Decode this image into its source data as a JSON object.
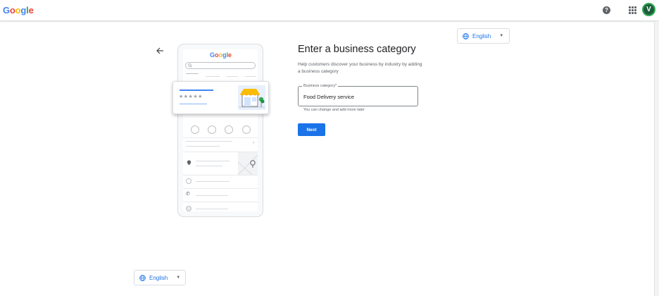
{
  "header": {
    "logo_letters": [
      "G",
      "o",
      "o",
      "g",
      "l",
      "e"
    ],
    "help_icon": "help-icon",
    "apps_icon": "apps-grid-icon",
    "avatar_letter": "V",
    "avatar_color": "#1b5e3b"
  },
  "language_top": {
    "label": "English",
    "icon": "globe-icon"
  },
  "language_bottom": {
    "label": "English",
    "icon": "globe-icon"
  },
  "back_icon": "arrow-back-icon",
  "illustration": {
    "logo_letters": [
      "G",
      "o",
      "o",
      "g",
      "l",
      "e"
    ],
    "stars": "★★★★★"
  },
  "form": {
    "title": "Enter a business category",
    "description": "Help customers discover your business by industry by adding a business category",
    "field_label": "Business category*",
    "field_value": "Food Delivery service",
    "field_hint": "You can change and add more later",
    "next_label": "Next"
  },
  "colors": {
    "accent": "#1a73e8",
    "google_blue": "#4285f4",
    "google_red": "#ea4335",
    "google_yellow": "#fbbc05",
    "google_green": "#34a853"
  }
}
